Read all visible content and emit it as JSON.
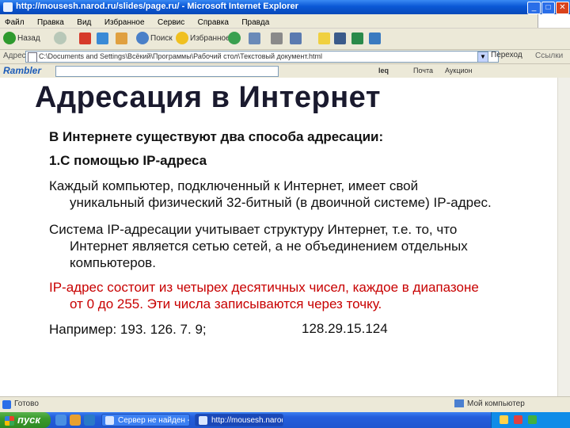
{
  "window": {
    "title": "http://mousesh.narod.ru/slides/page.ru/ - Microsoft Internet Explorer",
    "minimize": "_",
    "maximize": "□",
    "close": "✕"
  },
  "menu": [
    "Файл",
    "Правка",
    "Вид",
    "Избранное",
    "Сервис",
    "Справка",
    "Правда"
  ],
  "toolbar": {
    "back": "Назад",
    "search": "Поиск",
    "favorites": "Избранное",
    "icons": [
      "back-icon",
      "forward-icon",
      "stop-icon",
      "refresh-icon",
      "home-icon",
      "search-icon",
      "favorites-icon",
      "history-icon",
      "mail-icon",
      "print-icon",
      "edit-icon",
      "messenger-icon"
    ]
  },
  "address": {
    "label": "Адрес:",
    "value": "C:\\Documents and Settings\\Всёкий\\Программы\\Рабочий стол\\Текстовый документ.html",
    "go": "Переход",
    "links": "Ссылки"
  },
  "rambler": {
    "logo": "Rambler",
    "items": [
      "Ieq",
      "Почта",
      "Аукцион"
    ]
  },
  "slide": {
    "title": "Адресация в Интернет",
    "intro": "В Интернете существуют два способа адресации:",
    "point1": "1.С помощью IP-адреса",
    "p1_first": "Каждый компьютер, подключенный к Интернет, имеет свой",
    "p1_rest": "уникальный физический 32-битный (в двоичной системе) IP-адрес.",
    "p2_first": "Система IP-адресации учитывает структуру Интернет, т.е. то, что",
    "p2_rest1": "Интернет является сетью сетей, а не объединением отдельных",
    "p2_rest2": "компьютеров.",
    "p3_first": "IP-адрес состоит из четырех десятичных чисел, каждое в диапазоне",
    "p3_rest": "от 0 до 255. Эти числа записываются через точку.",
    "example_label": "Например: 193. 126. 7. 9;",
    "example_ip2": "128.29.15.124"
  },
  "status": {
    "text": "Готово",
    "zone": "Мой компьютер"
  },
  "taskbar": {
    "start": "пуск",
    "tasks": [
      "Сервер не найден - ...",
      "http://mousesh.narod..."
    ],
    "clock": ""
  },
  "colors": {
    "accent": "#c80000",
    "titlebar": "#0a58d6",
    "start": "#3a9a2c"
  }
}
